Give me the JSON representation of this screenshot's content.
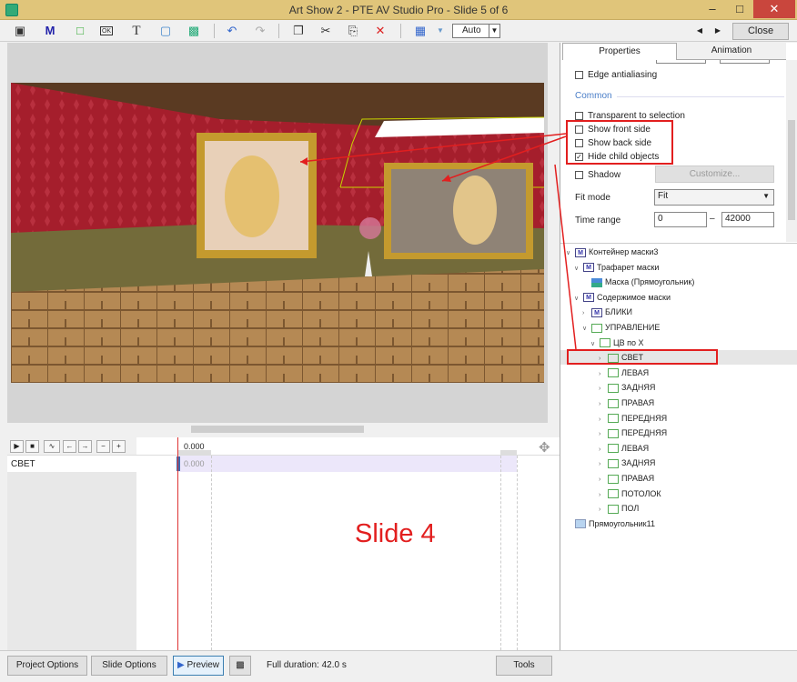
{
  "window": {
    "title": "Art Show 2 - PTE AV Studio Pro - Slide 5 of 6",
    "minimize_icon": "minimize-icon",
    "maximize_icon": "maximize-icon",
    "close_icon": "close-icon"
  },
  "toolbar": {
    "zoom": "Auto",
    "close_label": "Close",
    "icons": [
      "camera-icon",
      "mask-icon",
      "rectangle-icon",
      "button-icon",
      "text-icon",
      "frame-icon",
      "image-icon",
      "undo-icon",
      "redo-icon",
      "copy-icon",
      "cut-icon",
      "paste-icon",
      "delete-icon",
      "grid-icon"
    ]
  },
  "properties": {
    "tabs": [
      "Properties",
      "Animation"
    ],
    "edge_antialiasing": "Edge antialiasing",
    "section_common": "Common",
    "transparent_to_selection": "Transparent to selection",
    "show_front_side": "Show front side",
    "show_back_side": "Show back side",
    "hide_child_objects": "Hide child objects",
    "shadow": "Shadow",
    "customize": "Customize...",
    "fit_mode_label": "Fit mode",
    "fit_mode_value": "Fit",
    "time_range_label": "Time range",
    "time_range_from": "0",
    "time_range_sep": "–",
    "time_range_to": "42000",
    "checked": {
      "edge_antialiasing": false,
      "transparent_to_selection": false,
      "show_front_side": false,
      "show_back_side": false,
      "hide_child_objects": true,
      "shadow": false
    }
  },
  "tree": {
    "nodes": [
      {
        "label": "Контейнер маски3",
        "icon": "mask-container-icon",
        "level": 0,
        "expanded": true
      },
      {
        "label": "Трафарет маски",
        "icon": "mask-stencil-icon",
        "level": 1,
        "expanded": true
      },
      {
        "label": "Маска (Прямоугольник)",
        "icon": "image-icon",
        "level": 2,
        "expanded": null
      },
      {
        "label": "Содержимое маски",
        "icon": "mask-content-icon",
        "level": 1,
        "expanded": true
      },
      {
        "label": "БЛИКИ",
        "icon": "mask-icon",
        "level": 2,
        "expanded": false
      },
      {
        "label": "УПРАВЛЕНИЕ",
        "icon": "frame-icon",
        "level": 2,
        "expanded": true
      },
      {
        "label": "ЦВ по X",
        "icon": "frame-icon",
        "level": 3,
        "expanded": true
      },
      {
        "label": "СВЕТ",
        "icon": "frame-icon",
        "level": 4,
        "expanded": false,
        "selected": true
      },
      {
        "label": "ЛЕВАЯ",
        "icon": "frame-icon",
        "level": 4,
        "expanded": false
      },
      {
        "label": "ЗАДНЯЯ",
        "icon": "frame-icon",
        "level": 4,
        "expanded": false
      },
      {
        "label": "ПРАВАЯ",
        "icon": "frame-icon",
        "level": 4,
        "expanded": false
      },
      {
        "label": "ПЕРЕДНЯЯ",
        "icon": "frame-icon",
        "level": 4,
        "expanded": false
      },
      {
        "label": "ПЕРЕДНЯЯ",
        "icon": "frame-icon",
        "level": 4,
        "expanded": false
      },
      {
        "label": "ЛЕВАЯ",
        "icon": "frame-icon",
        "level": 4,
        "expanded": false
      },
      {
        "label": "ЗАДНЯЯ",
        "icon": "frame-icon",
        "level": 4,
        "expanded": false
      },
      {
        "label": "ПРАВАЯ",
        "icon": "frame-icon",
        "level": 4,
        "expanded": false
      },
      {
        "label": "ПОТОЛОК",
        "icon": "frame-icon",
        "level": 4,
        "expanded": false
      },
      {
        "label": "ПОЛ",
        "icon": "frame-icon",
        "level": 4,
        "expanded": false
      },
      {
        "label": "Прямоугольник11",
        "icon": "gradient-rect-icon",
        "level": 0,
        "expanded": null
      }
    ]
  },
  "timeline": {
    "ruler_time": "0.000",
    "row_label": "СВЕТ",
    "row_time": "0.000",
    "annotation": "Slide 4",
    "move_icon": "move-arrows-icon"
  },
  "status": {
    "project_options": "Project Options",
    "slide_options": "Slide Options",
    "preview": "Preview",
    "full_duration": "Full duration: 42.0 s",
    "tools": "Tools"
  },
  "colors": {
    "annotation_red": "#e21f1f",
    "title_bar": "#e0c57a",
    "selection_box": "#c8d400"
  }
}
